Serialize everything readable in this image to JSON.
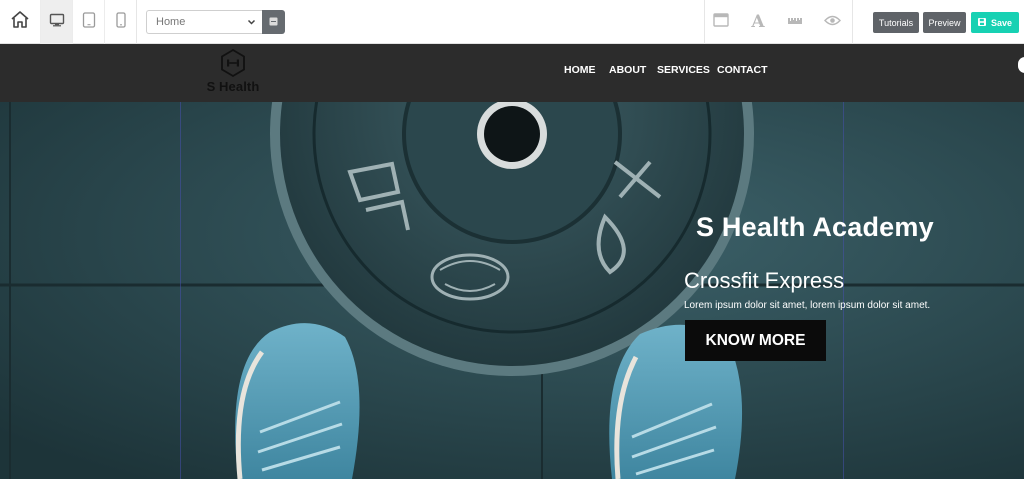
{
  "toolbar": {
    "page_select": {
      "value": "Home"
    },
    "buttons": {
      "tutorials": "Tutorials",
      "preview": "Preview",
      "save": "Save"
    },
    "colors": {
      "save": "#17d1b3",
      "dark_button": "#5f6368"
    },
    "icons": {
      "home": "home-icon",
      "devices": [
        "desktop-icon",
        "tablet-icon",
        "mobile-icon"
      ],
      "page_add": "add-page-icon",
      "tools": [
        "layout-icon",
        "typography-icon",
        "ruler-icon",
        "eye-icon"
      ],
      "save": "floppy-disk-icon"
    }
  },
  "site": {
    "logo": {
      "text": "S Health",
      "icon": "dumbbell-hexagon-icon"
    },
    "nav": [
      "HOME",
      "ABOUT",
      "SERVICES",
      "CONTACT"
    ],
    "nav_background": "#2c2c2c"
  },
  "hero": {
    "title": "S Health Academy",
    "subtitle": "Crossfit Express",
    "text": "Lorem ipsum dolor sit amet, lorem ipsum dolor sit amet.",
    "button": "KNOW MORE",
    "image": "weight plate and sneakers on gym floor"
  }
}
